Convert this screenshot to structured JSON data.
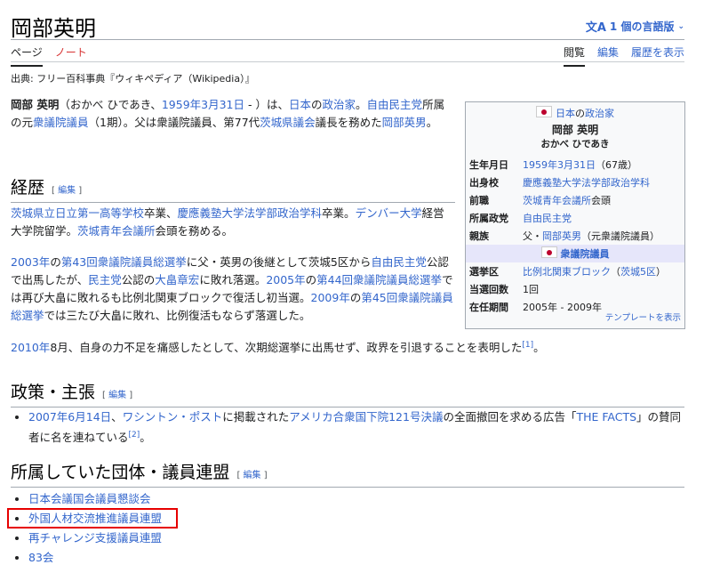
{
  "page": {
    "title": "岡部英明",
    "lang_button": "1 個の言語版",
    "tabs_left": [
      "ページ",
      "ノート"
    ],
    "tabs_right": [
      "閲覧",
      "編集",
      "履歴を表示"
    ],
    "from": "出典: フリー百科事典『ウィキペディア（Wikipedia）』"
  },
  "intro": {
    "name_bold": "岡部 英明",
    "t1": "（おかべ ひであき、",
    "l1": "1959年3月31日",
    "t2": " - ）は、",
    "l2": "日本",
    "t3": "の",
    "l3": "政治家",
    "t4": "。",
    "l4": "自由民主党",
    "t5": "所属の元",
    "l5": "衆議院議員",
    "t6": "（1期）。父は衆議院議員、第77代",
    "l6": "茨城県議会",
    "t7": "議長を務めた",
    "l7": "岡部英男",
    "t8": "。"
  },
  "edit_label": "編集",
  "career": {
    "heading": "経歴",
    "p1": {
      "l1": "茨城県立日立第一高等学校",
      "t1": "卒業、",
      "l2": "慶應義塾大学法学部政治学科",
      "t2": "卒業。",
      "l3": "デンバー大学",
      "t3": "経営大学院留学。",
      "l4": "茨城青年会議所",
      "t4": "会頭を務める。"
    },
    "p2": {
      "l1": "2003年",
      "t1": "の",
      "l2": "第43回衆議院議員総選挙",
      "t2": "に父・英男の後継として茨城5区から",
      "l3": "自由民主党",
      "t3": "公認で出馬したが、",
      "l4": "民主党",
      "t4": "公認の",
      "l5": "大畠章宏",
      "t5": "に敗れ落選。",
      "l6": "2005年",
      "t6": "の",
      "l7": "第44回衆議院議員総選挙",
      "t7": "では再び大畠に敗れるも比例北関東ブロックで復活し初当選。",
      "l8": "2009年",
      "t8": "の",
      "l9": "第45回衆議院議員総選挙",
      "t9": "では三たび大畠に敗れ、比例復活もならず落選した。"
    },
    "p3": {
      "l1": "2010年",
      "t1": "8月、自身の力不足を痛感したとして、次期総選挙に出馬せず、政界を引退することを表明した",
      "ref": "[1]",
      "t2": "。"
    }
  },
  "policy": {
    "heading": "政策・主張",
    "l1": "2007年6月14日",
    "t1": "、",
    "l2": "ワシントン・ポスト",
    "t2": "に掲載された",
    "l3": "アメリカ合衆国下院121号決議",
    "t3": "の全面撤回を求める広告「",
    "l4": "THE FACTS",
    "t4": "」の賛同者に名を連ねている",
    "ref": "[2]",
    "t5": "。"
  },
  "groups": {
    "heading": "所属していた団体・議員連盟",
    "items": [
      "日本会議国会議員懇談会",
      "外国人材交流推進議員連盟",
      "再チャレンジ支援議員連盟",
      "83会"
    ]
  },
  "infobox": {
    "head_link1": "日本",
    "head_text": "の",
    "head_link2": "政治家",
    "name": "岡部 英明",
    "kana": "おかべ ひであき",
    "rows": [
      {
        "label": "生年月日",
        "link": "1959年3月31日",
        "text": "（67歳）"
      },
      {
        "label": "出身校",
        "link": "慶應義塾大学法学部政治学科",
        "text": ""
      },
      {
        "label": "前職",
        "link": "茨城青年会議所",
        "text": "会頭"
      },
      {
        "label": "所属政党",
        "link": "自由民主党",
        "text": ""
      },
      {
        "label": "親族",
        "pre": "父・",
        "link": "岡部英男",
        "text": "（元衆議院議員）"
      }
    ],
    "band": "衆議院議員",
    "rows2": [
      {
        "label": "選挙区",
        "link": "比例北関東ブロック",
        "text": "（",
        "link2": "茨城5区",
        "text2": "）"
      },
      {
        "label": "当選回数",
        "text": "1回"
      },
      {
        "label": "在任期間",
        "text": "2005年 - 2009年"
      }
    ],
    "foot": "テンプレートを表示"
  },
  "colors": {
    "link": "#3366cc",
    "highlight": "#e60000",
    "infobox_band": "#e6e6fa"
  }
}
